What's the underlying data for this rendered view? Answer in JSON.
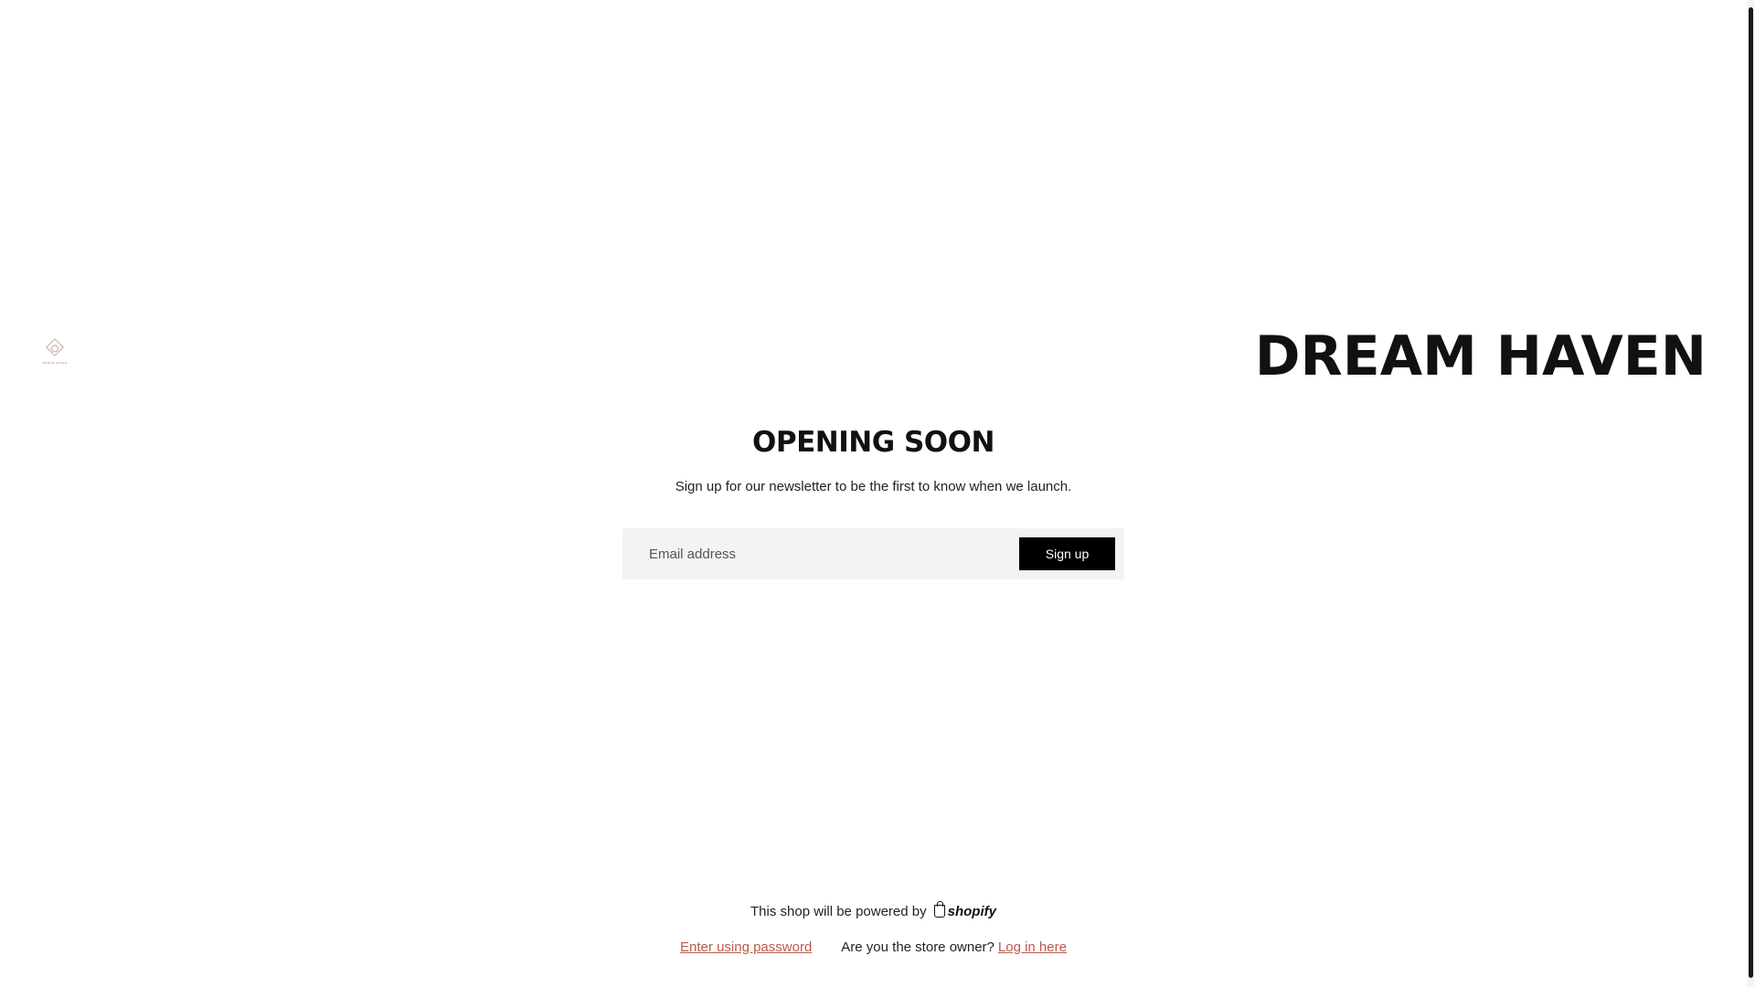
{
  "header": {
    "brand_title": "DREAM HAVEN",
    "logo_icon": "dream-haven-logo-icon"
  },
  "main": {
    "heading": "OPENING SOON",
    "subtext": "Sign up for our newsletter to be the first to know when we launch."
  },
  "form": {
    "email_placeholder": "Email address",
    "email_value": "",
    "submit_label": "Sign up"
  },
  "footer": {
    "powered_text": "This shop will be powered by",
    "shopify_label": "shopify",
    "password_link": "Enter using password",
    "owner_question": "Are you the store owner?",
    "login_link": "Log in here"
  },
  "colors": {
    "background": "#ffffff",
    "text": "#121212",
    "button": "#000000",
    "input_background": "#f3f3f3",
    "link": "#b85a4a"
  }
}
